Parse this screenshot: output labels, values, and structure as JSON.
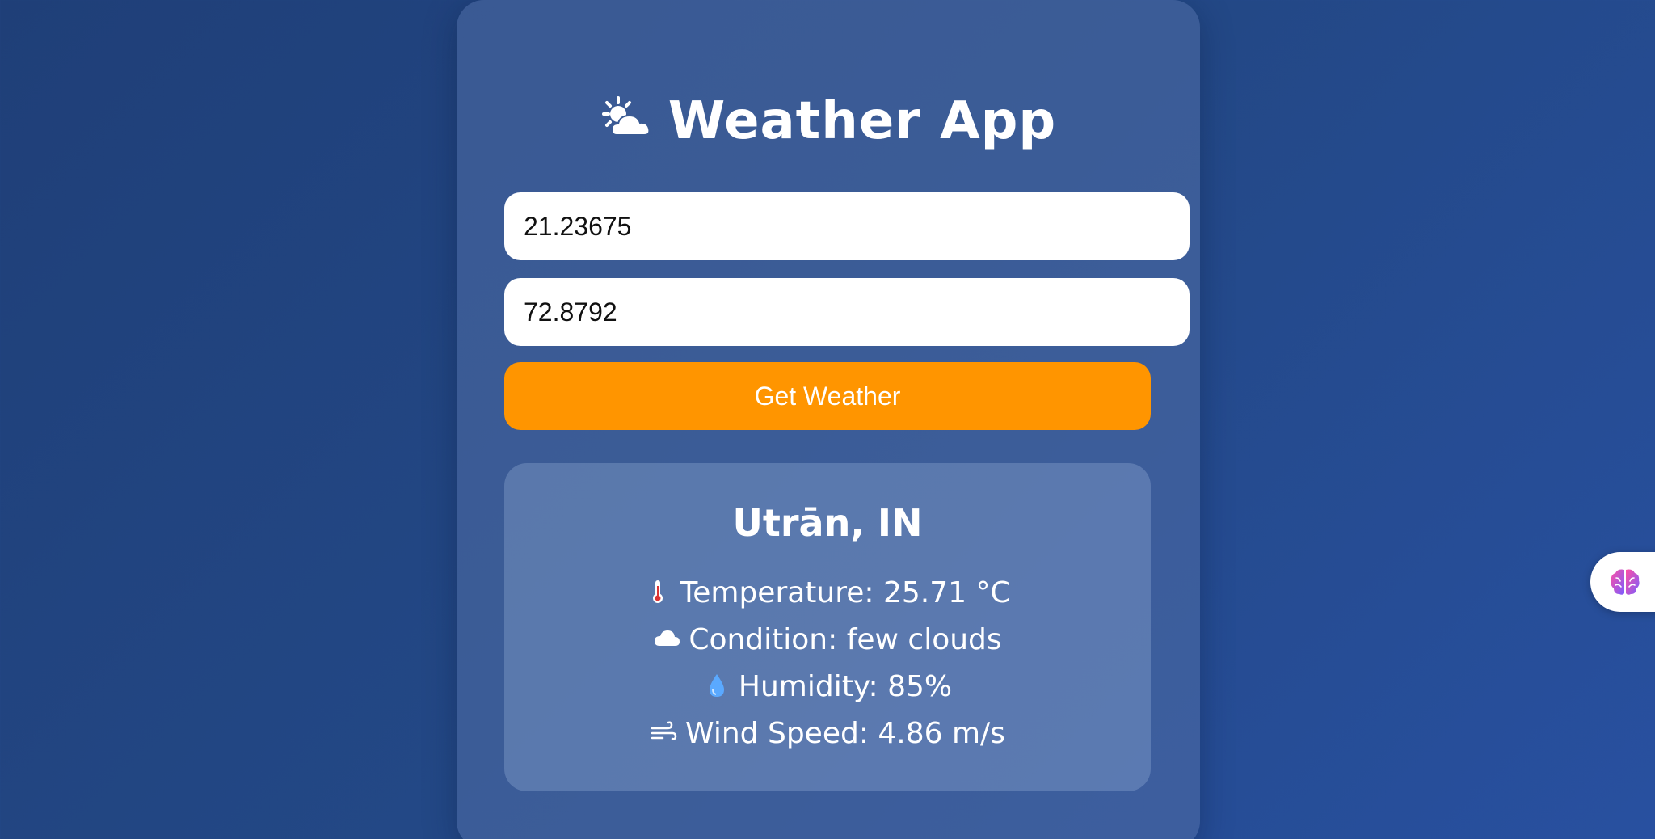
{
  "app": {
    "title": "Weather App",
    "title_icon": "sun-behind-cloud-icon"
  },
  "form": {
    "latitude_value": "21.23675",
    "longitude_value": "72.8792",
    "submit_label": "Get Weather"
  },
  "result": {
    "location": "Utrān, IN",
    "rows": [
      {
        "icon": "thermometer-icon",
        "text": "Temperature: 25.71 °C"
      },
      {
        "icon": "cloud-icon",
        "text": "Condition: few clouds"
      },
      {
        "icon": "droplet-icon",
        "text": "Humidity: 85%"
      },
      {
        "icon": "wind-icon",
        "text": "Wind Speed: 4.86 m/s"
      }
    ]
  },
  "side_tab": {
    "icon": "brain-icon"
  },
  "colors": {
    "background": "#234886",
    "accent": "#ff9500",
    "text": "#ffffff"
  }
}
